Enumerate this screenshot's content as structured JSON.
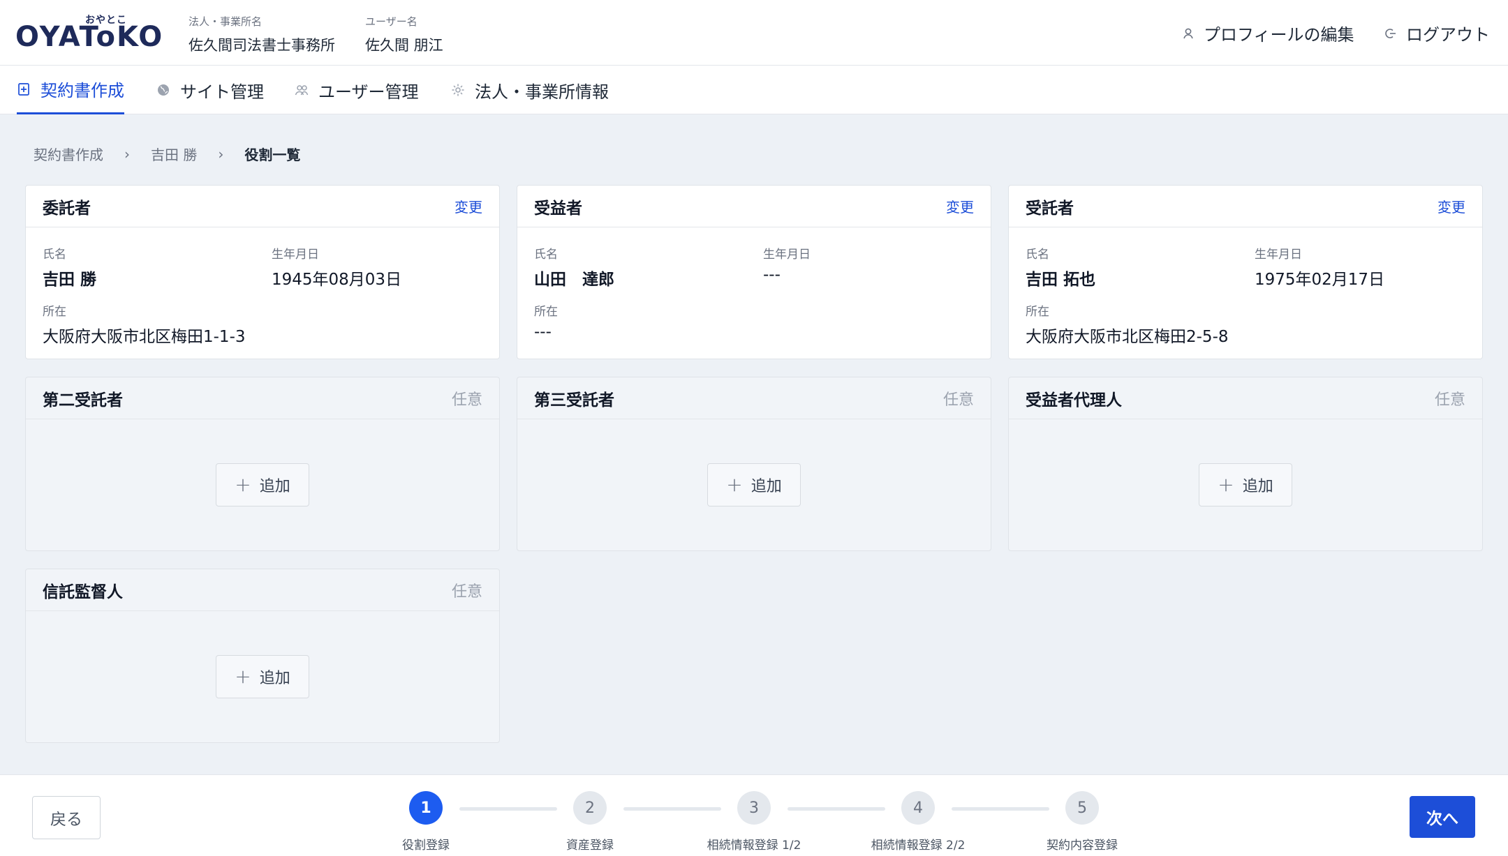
{
  "brand": {
    "logo_text": "OYAToKO",
    "logo_kana": "おやとこ"
  },
  "header": {
    "office_label": "法人・事業所名",
    "office_value": "佐久間司法書士事務所",
    "user_label": "ユーザー名",
    "user_value": "佐久間 朋江",
    "profile_link": "プロフィールの編集",
    "logout_link": "ログアウト"
  },
  "nav": {
    "items": [
      {
        "label": "契約書作成",
        "icon": "document-plus-icon",
        "active": true
      },
      {
        "label": "サイト管理",
        "icon": "globe-icon",
        "active": false
      },
      {
        "label": "ユーザー管理",
        "icon": "users-icon",
        "active": false
      },
      {
        "label": "法人・事業所情報",
        "icon": "gear-icon",
        "active": false
      }
    ]
  },
  "breadcrumb": {
    "items": [
      "契約書作成",
      "吉田 勝",
      "役割一覧"
    ],
    "separator": "›"
  },
  "cards": {
    "settlor": {
      "title": "委託者",
      "action": "変更",
      "name_label": "氏名",
      "name": "吉田 勝",
      "dob_label": "生年月日",
      "dob": "1945年08月03日",
      "address_label": "所在",
      "address": "大阪府大阪市北区梅田1-1-3"
    },
    "beneficiary": {
      "title": "受益者",
      "action": "変更",
      "name_label": "氏名",
      "name": "山田　達郎",
      "dob_label": "生年月日",
      "dob": "---",
      "address_label": "所在",
      "address": "---"
    },
    "trustee": {
      "title": "受託者",
      "action": "変更",
      "name_label": "氏名",
      "name": "吉田 拓也",
      "dob_label": "生年月日",
      "dob": "1975年02月17日",
      "address_label": "所在",
      "address": "大阪府大阪市北区梅田2-5-8"
    },
    "second_trustee": {
      "title": "第二受託者",
      "optional": "任意",
      "add_label": "追加"
    },
    "third_trustee": {
      "title": "第三受託者",
      "optional": "任意",
      "add_label": "追加"
    },
    "beneficiary_agent": {
      "title": "受益者代理人",
      "optional": "任意",
      "add_label": "追加"
    },
    "trust_supervisor": {
      "title": "信託監督人",
      "optional": "任意",
      "add_label": "追加"
    }
  },
  "footer": {
    "back_label": "戻る",
    "next_label": "次へ",
    "current_step": 1,
    "steps": [
      {
        "number": "1",
        "label": "役割登録"
      },
      {
        "number": "2",
        "label": "資産登録"
      },
      {
        "number": "3",
        "label": "相続情報登録 1/2"
      },
      {
        "number": "4",
        "label": "相続情報登録 2/2"
      },
      {
        "number": "5",
        "label": "契約内容登録"
      }
    ]
  },
  "colors": {
    "accent": "#1d4ed8",
    "step_active": "#1d5cf0",
    "background": "#edf1f6"
  }
}
